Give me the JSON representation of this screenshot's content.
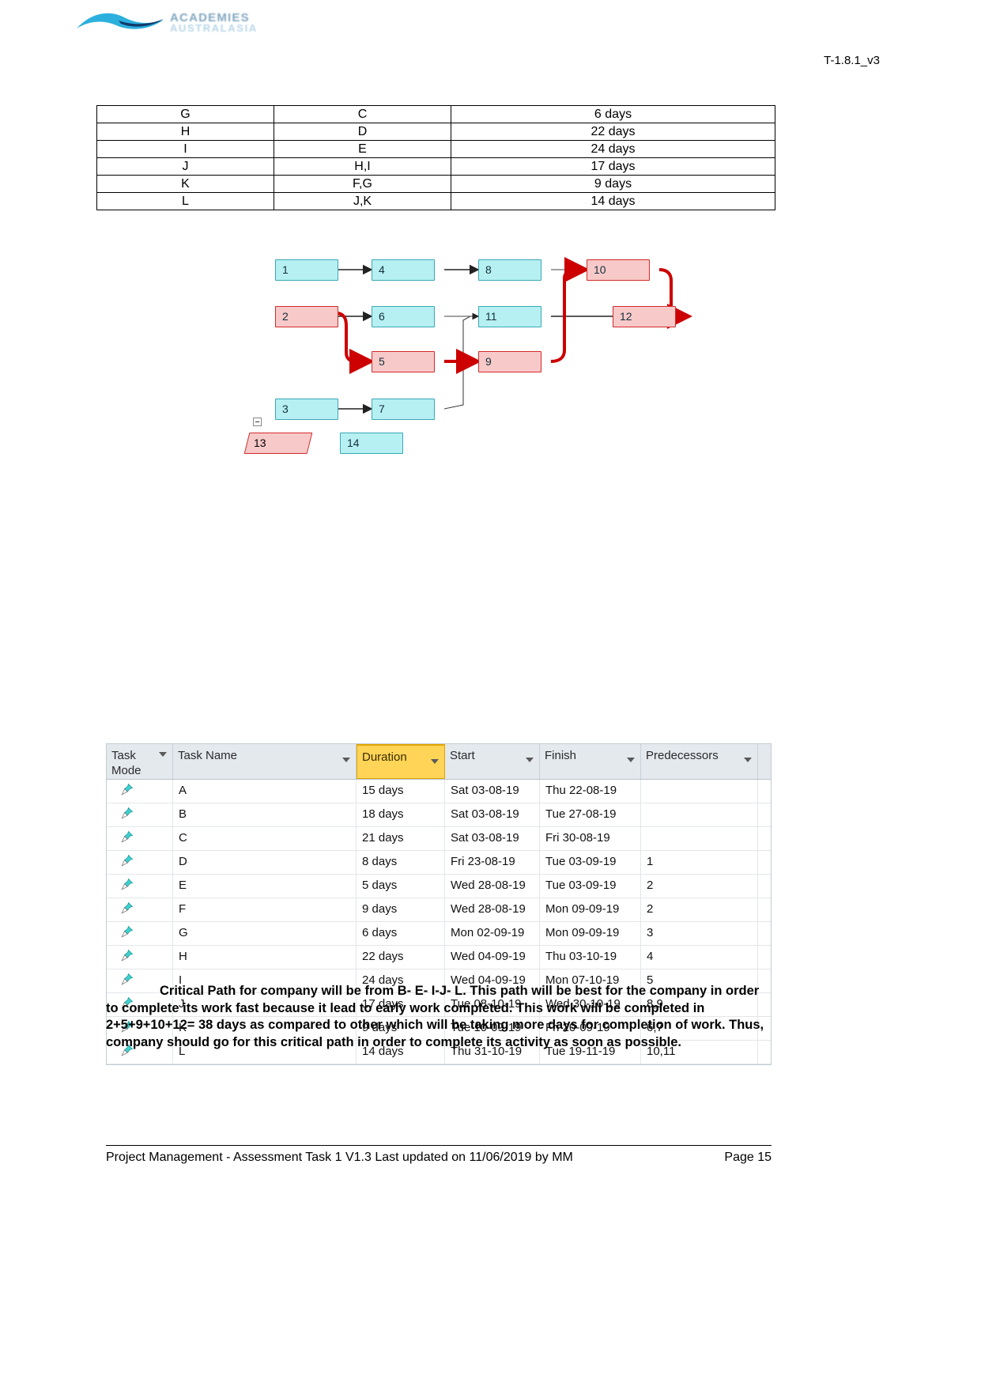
{
  "header": {
    "logo_line1": "ACADEMIES",
    "logo_line2": "AUSTRALASIA",
    "doc_code": "T-1.8.1_v3"
  },
  "activity_table": {
    "rows": [
      {
        "activity": "G",
        "predecessor": "C",
        "duration": "6 days"
      },
      {
        "activity": "H",
        "predecessor": "D",
        "duration": "22 days"
      },
      {
        "activity": "I",
        "predecessor": "E",
        "duration": "24 days"
      },
      {
        "activity": "J",
        "predecessor": "H,I",
        "duration": "17 days"
      },
      {
        "activity": "K",
        "predecessor": "F,G",
        "duration": "9 days"
      },
      {
        "activity": "L",
        "predecessor": "J,K",
        "duration": "14 days"
      }
    ]
  },
  "network_diagram": {
    "nodes": [
      {
        "id": "1",
        "label": "1",
        "type": "blue"
      },
      {
        "id": "2",
        "label": "2",
        "type": "red"
      },
      {
        "id": "3",
        "label": "3",
        "type": "blue"
      },
      {
        "id": "4",
        "label": "4",
        "type": "blue"
      },
      {
        "id": "5",
        "label": "5",
        "type": "red"
      },
      {
        "id": "6",
        "label": "6",
        "type": "blue"
      },
      {
        "id": "7",
        "label": "7",
        "type": "blue"
      },
      {
        "id": "8",
        "label": "8",
        "type": "blue"
      },
      {
        "id": "9",
        "label": "9",
        "type": "red"
      },
      {
        "id": "10",
        "label": "10",
        "type": "red"
      },
      {
        "id": "11",
        "label": "11",
        "type": "blue"
      },
      {
        "id": "12",
        "label": "12",
        "type": "red"
      },
      {
        "id": "13",
        "label": "13",
        "type": "red-parallelogram"
      },
      {
        "id": "14",
        "label": "14",
        "type": "blue"
      }
    ],
    "critical_path_color": "#cc0000",
    "normal_link_color": "#333333"
  },
  "gantt": {
    "columns": [
      {
        "key": "mode",
        "label": "Task\nMode",
        "highlighted": false
      },
      {
        "key": "name",
        "label": "Task Name",
        "highlighted": false
      },
      {
        "key": "dur",
        "label": "Duration",
        "highlighted": true
      },
      {
        "key": "start",
        "label": "Start",
        "highlighted": false
      },
      {
        "key": "finish",
        "label": "Finish",
        "highlighted": false
      },
      {
        "key": "pred",
        "label": "Predecessors",
        "highlighted": false
      }
    ],
    "header": {
      "task_mode": "Task Mode",
      "task_name": "Task Name",
      "duration": "Duration",
      "start": "Start",
      "finish": "Finish",
      "predecessors": "Predecessors"
    },
    "rows": [
      {
        "mode": "manually-scheduled-pin",
        "name": "A",
        "dur": "15 days",
        "start": "Sat 03-08-19",
        "finish": "Thu 22-08-19",
        "pred": ""
      },
      {
        "mode": "manually-scheduled-pin",
        "name": "B",
        "dur": "18 days",
        "start": "Sat 03-08-19",
        "finish": "Tue 27-08-19",
        "pred": ""
      },
      {
        "mode": "manually-scheduled-pin",
        "name": "C",
        "dur": "21 days",
        "start": "Sat 03-08-19",
        "finish": "Fri 30-08-19",
        "pred": ""
      },
      {
        "mode": "manually-scheduled-pin",
        "name": "D",
        "dur": "8 days",
        "start": "Fri 23-08-19",
        "finish": "Tue 03-09-19",
        "pred": "1"
      },
      {
        "mode": "manually-scheduled-pin",
        "name": "E",
        "dur": "5 days",
        "start": "Wed 28-08-19",
        "finish": "Tue 03-09-19",
        "pred": "2"
      },
      {
        "mode": "manually-scheduled-pin",
        "name": "F",
        "dur": "9 days",
        "start": "Wed 28-08-19",
        "finish": "Mon 09-09-19",
        "pred": "2"
      },
      {
        "mode": "manually-scheduled-pin",
        "name": "G",
        "dur": "6 days",
        "start": "Mon 02-09-19",
        "finish": "Mon 09-09-19",
        "pred": "3"
      },
      {
        "mode": "manually-scheduled-pin",
        "name": "H",
        "dur": "22 days",
        "start": "Wed 04-09-19",
        "finish": "Thu 03-10-19",
        "pred": "4"
      },
      {
        "mode": "manually-scheduled-pin",
        "name": "I",
        "dur": "24 days",
        "start": "Wed 04-09-19",
        "finish": "Mon 07-10-19",
        "pred": "5"
      },
      {
        "mode": "manually-scheduled-pin",
        "name": "J",
        "dur": "17 days",
        "start": "Tue 08-10-19",
        "finish": "Wed 30-10-19",
        "pred": "8,9"
      },
      {
        "mode": "manually-scheduled-pin",
        "name": "K",
        "dur": "9 days",
        "start": "Tue 10-09-19",
        "finish": "Fri 20-09-19",
        "pred": "6,7"
      },
      {
        "mode": "manually-scheduled-pin",
        "name": "L",
        "dur": "14 days",
        "start": "Thu 31-10-19",
        "finish": "Tue 19-11-19",
        "pred": "10,11"
      }
    ]
  },
  "paragraph": {
    "text": "Critical Path for company will be from B- E- I-J- L. This path will be best for the company in order to complete its work fast because it lead to early work completed. This work will be completed in 2+5+9+10+12= 38 days as compared to other which will be taking more days for completion of work. Thus, company should go for this critical path in order to complete its activity as soon as possible."
  },
  "footer": {
    "left": "Project Management - Assessment Task 1 V1.3 Last updated on 11/06/2019 by MM",
    "right": "Page 15"
  }
}
